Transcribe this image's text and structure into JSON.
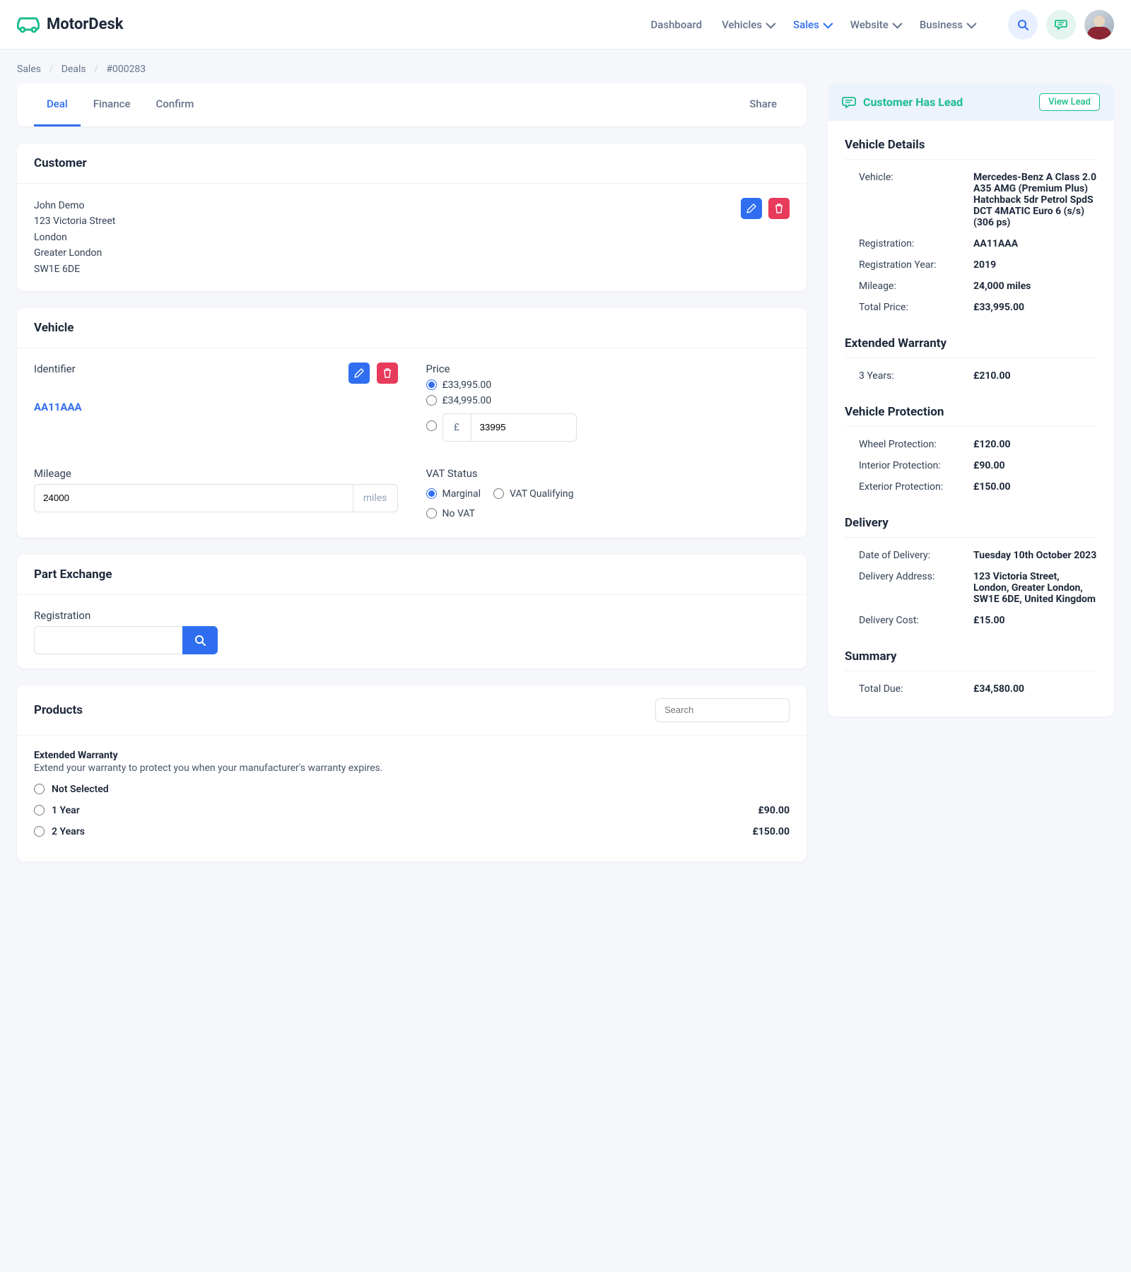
{
  "brand": "MotorDesk",
  "nav": {
    "dashboard": "Dashboard",
    "vehicles": "Vehicles",
    "sales": "Sales",
    "website": "Website",
    "business": "Business"
  },
  "breadcrumb": {
    "l1": "Sales",
    "l2": "Deals",
    "l3": "#000283"
  },
  "tabs": {
    "deal": "Deal",
    "finance": "Finance",
    "confirm": "Confirm",
    "share": "Share"
  },
  "customer": {
    "heading": "Customer",
    "name": "John Demo",
    "line1": "123 Victoria Street",
    "city": "London",
    "region": "Greater London",
    "postcode": "SW1E 6DE"
  },
  "vehicle": {
    "heading": "Vehicle",
    "identifier_label": "Identifier",
    "identifier_value": "AA11AAA",
    "price_label": "Price",
    "price_options": {
      "a": "£33,995.00",
      "b": "£34,995.00"
    },
    "custom_price_currency": "£",
    "custom_price_value": "33995",
    "mileage_label": "Mileage",
    "mileage_value": "24000",
    "mileage_unit": "miles",
    "vat_label": "VAT Status",
    "vat_options": {
      "marginal": "Marginal",
      "qualifying": "VAT Qualifying",
      "none": "No VAT"
    }
  },
  "partex": {
    "heading": "Part Exchange",
    "reg_label": "Registration"
  },
  "products": {
    "heading": "Products",
    "search_placeholder": "Search",
    "ew_title": "Extended Warranty",
    "ew_desc": "Extend your warranty to protect you when your manufacturer's warranty expires.",
    "opt_none": "Not Selected",
    "opt_1y": "1 Year",
    "opt_2y": "2 Years",
    "price_1y": "£90.00",
    "price_2y": "£150.00"
  },
  "lead": {
    "title": "Customer Has Lead",
    "view": "View Lead"
  },
  "details": {
    "vehicle_heading": "Vehicle Details",
    "vehicle_label": "Vehicle:",
    "vehicle_value": "Mercedes-Benz A Class 2.0 A35 AMG (Premium Plus) Hatchback 5dr Petrol SpdS DCT 4MATIC Euro 6 (s/s) (306 ps)",
    "reg_label": "Registration:",
    "reg_value": "AA11AAA",
    "regyear_label": "Registration Year:",
    "regyear_value": "2019",
    "mileage_label": "Mileage:",
    "mileage_value": "24,000 miles",
    "total_price_label": "Total Price:",
    "total_price_value": "£33,995.00",
    "ew_heading": "Extended Warranty",
    "ew_item_label": "3 Years:",
    "ew_item_value": "£210.00",
    "vp_heading": "Vehicle Protection",
    "wheel_label": "Wheel Protection:",
    "wheel_value": "£120.00",
    "interior_label": "Interior Protection:",
    "interior_value": "£90.00",
    "exterior_label": "Exterior Protection:",
    "exterior_value": "£150.00",
    "delivery_heading": "Delivery",
    "delivery_date_label": "Date of Delivery:",
    "delivery_date_value": "Tuesday 10th October 2023",
    "delivery_addr_label": "Delivery Address:",
    "delivery_addr_value": "123 Victoria Street, London, Greater London, SW1E 6DE, United Kingdom",
    "delivery_cost_label": "Delivery Cost:",
    "delivery_cost_value": "£15.00",
    "summary_heading": "Summary",
    "total_due_label": "Total Due:",
    "total_due_value": "£34,580.00"
  }
}
